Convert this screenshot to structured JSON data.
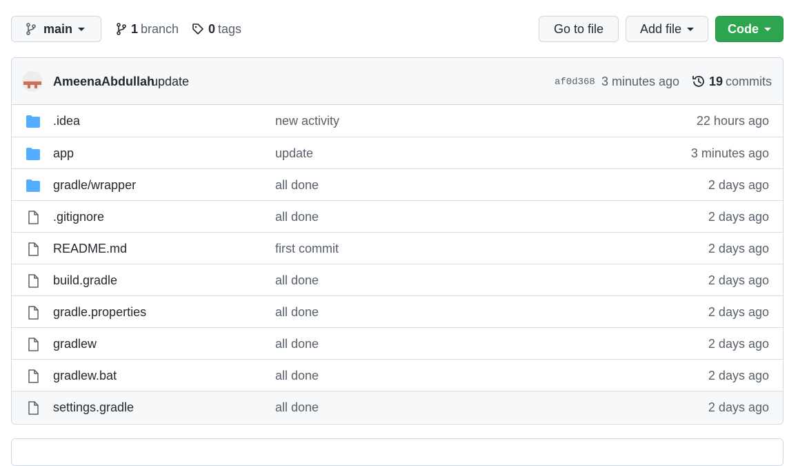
{
  "topbar": {
    "branch_label": "main",
    "branch_count": "1",
    "branch_word": "branch",
    "tag_count": "0",
    "tag_word": "tags",
    "goto_label": "Go to file",
    "addfile_label": "Add file",
    "code_label": "Code"
  },
  "commit": {
    "author": "AmeenaAbdullah",
    "message": "update",
    "sha": "af0d368",
    "time": "3 minutes ago",
    "count": "19",
    "count_word": "commits"
  },
  "files": [
    {
      "name": ".idea",
      "message": "new activity",
      "age": "22 hours ago",
      "type": "folder"
    },
    {
      "name": "app",
      "message": "update",
      "age": "3 minutes ago",
      "type": "folder"
    },
    {
      "name": "gradle/wrapper",
      "message": "all done",
      "age": "2 days ago",
      "type": "folder"
    },
    {
      "name": ".gitignore",
      "message": "all done",
      "age": "2 days ago",
      "type": "file"
    },
    {
      "name": "README.md",
      "message": "first commit",
      "age": "2 days ago",
      "type": "file"
    },
    {
      "name": "build.gradle",
      "message": "all done",
      "age": "2 days ago",
      "type": "file"
    },
    {
      "name": "gradle.properties",
      "message": "all done",
      "age": "2 days ago",
      "type": "file"
    },
    {
      "name": "gradlew",
      "message": "all done",
      "age": "2 days ago",
      "type": "file"
    },
    {
      "name": "gradlew.bat",
      "message": "all done",
      "age": "2 days ago",
      "type": "file"
    },
    {
      "name": "settings.gradle",
      "message": "all done",
      "age": "2 days ago",
      "type": "file"
    }
  ],
  "colors": {
    "code_button": "#2da44e",
    "folder_icon": "#54aeff",
    "border": "#d0d7de"
  },
  "icons": {
    "branch": "git-branch-icon",
    "tag": "tag-icon",
    "history": "history-icon",
    "folder": "folder-icon",
    "file": "file-icon"
  }
}
